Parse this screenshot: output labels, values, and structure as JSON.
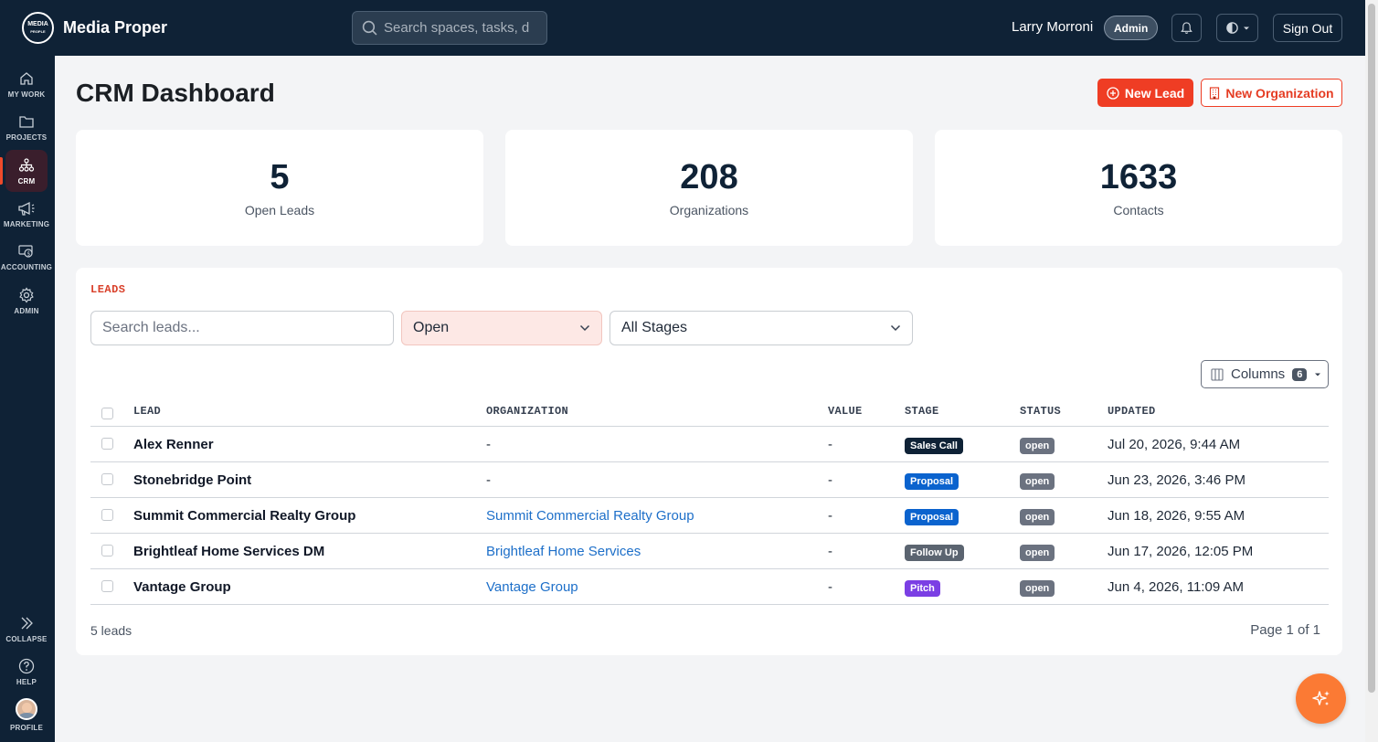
{
  "brand": {
    "name": "Media Proper",
    "logo_line1": "MEDIA",
    "logo_line2": "PROPLE"
  },
  "search": {
    "placeholder": "Search spaces, tasks, d"
  },
  "user": {
    "name": "Larry Morroni",
    "role": "Admin"
  },
  "topbar": {
    "signout_label": "Sign Out"
  },
  "sidebar": {
    "items": [
      {
        "label": "MY WORK",
        "icon": "home-icon"
      },
      {
        "label": "PROJECTS",
        "icon": "folder-icon"
      },
      {
        "label": "CRM",
        "icon": "org-chart-icon",
        "active": true
      },
      {
        "label": "MARKETING",
        "icon": "megaphone-icon"
      },
      {
        "label": "ACCOUNTING",
        "icon": "money-icon"
      },
      {
        "label": "ADMIN",
        "icon": "gear-icon"
      }
    ],
    "bottom": [
      {
        "label": "COLLAPSE",
        "icon": "double-chevron-icon"
      },
      {
        "label": "HELP",
        "icon": "help-icon"
      },
      {
        "label": "PROFILE",
        "icon": "avatar"
      }
    ]
  },
  "page": {
    "title": "CRM Dashboard",
    "new_lead_label": "New Lead",
    "new_org_label": "New Organization"
  },
  "stats": [
    {
      "value": "5",
      "label": "Open Leads"
    },
    {
      "value": "208",
      "label": "Organizations"
    },
    {
      "value": "1633",
      "label": "Contacts"
    }
  ],
  "leads": {
    "heading": "LEADS",
    "search_placeholder": "Search leads...",
    "status_filter": "Open",
    "stage_filter": "All Stages",
    "columns_label": "Columns",
    "columns_count": "6",
    "headers": {
      "lead": "LEAD",
      "organization": "ORGANIZATION",
      "value": "VALUE",
      "stage": "STAGE",
      "status": "STATUS",
      "updated": "UPDATED"
    },
    "rows": [
      {
        "lead": "Alex Renner",
        "organization": "-",
        "value": "-",
        "stage": "Sales Call",
        "stage_color": "#0f2236",
        "status": "open",
        "updated": "Jul 20, 2026, 9:44 AM"
      },
      {
        "lead": "Stonebridge Point",
        "organization": "-",
        "value": "-",
        "stage": "Proposal",
        "stage_color": "#0b63ce",
        "status": "open",
        "updated": "Jun 23, 2026, 3:46 PM"
      },
      {
        "lead": "Summit Commercial Realty Group",
        "organization": "Summit Commercial Realty Group",
        "value": "-",
        "stage": "Proposal",
        "stage_color": "#0b63ce",
        "status": "open",
        "updated": "Jun 18, 2026, 9:55 AM"
      },
      {
        "lead": "Brightleaf Home Services DM",
        "organization": "Brightleaf Home Services",
        "value": "-",
        "stage": "Follow Up",
        "stage_color": "#5b6470",
        "status": "open",
        "updated": "Jun 17, 2026, 12:05 PM"
      },
      {
        "lead": "Vantage Group",
        "organization": "Vantage Group",
        "value": "-",
        "stage": "Pitch",
        "stage_color": "#7b3fe4",
        "status": "open",
        "updated": "Jun 4, 2026, 11:09 AM"
      }
    ],
    "count_text": "5 leads",
    "page_text": "Page 1 of 1"
  },
  "colors": {
    "navy": "#0f2236",
    "accent": "#ef3d24",
    "link": "#1d6fc9",
    "fab": "#fb7a34"
  }
}
